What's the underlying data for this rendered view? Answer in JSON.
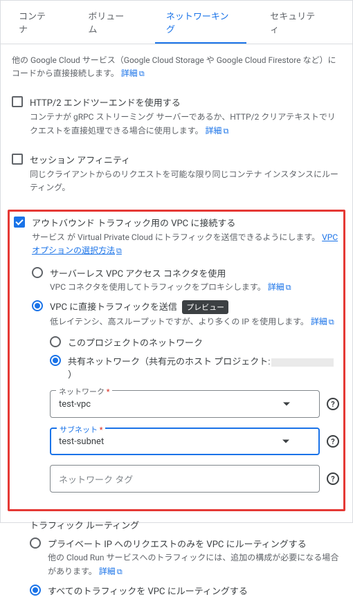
{
  "tabs": {
    "container": "コンテナ",
    "volumes": "ボリューム",
    "networking": "ネットワーキング",
    "security": "セキュリティ"
  },
  "intro": {
    "text": "他の Google Cloud サービス（Google Cloud Storage や Google Cloud Firestore など）にコードから直接接続します。",
    "link_label": "詳細"
  },
  "http2": {
    "title": "HTTP/2 エンドツーエンドを使用する",
    "desc": "コンテナが gRPC ストリーミング サーバーであるか、HTTP/2 クリアテキストでリクエストを直接処理できる場合に使用します。",
    "link_label": "詳細"
  },
  "session_affinity": {
    "title": "セッション アフィニティ",
    "desc": "同じクライアントからのリクエストを可能な限り同じコンテナ インスタンスにルーティング。"
  },
  "vpc_connect": {
    "title": "アウトバウンド トラフィック用の VPC に接続する",
    "desc_prefix": "サービス が Virtual Private Cloud にトラフィックを送信できるようにします。",
    "link_label": "VPC オプションの選択方法"
  },
  "method": {
    "serverless": {
      "title": "サーバーレス VPC アクセス コネクタを使用",
      "desc": "VPC コネクタを使用してトラフィックをプロキシします。",
      "link_label": "詳細"
    },
    "direct": {
      "title_prefix": "VPC に直接トラフィックを送信",
      "badge": "プレビュー",
      "desc": "低レイテンシ、高スループットですが、より多くの IP を使用します。",
      "link_label": "詳細"
    }
  },
  "network_scope": {
    "project": "このプロジェクトのネットワーク",
    "shared_prefix": "共有ネットワーク（共有元のホスト プロジェクト:",
    "shared_suffix": "）"
  },
  "fields": {
    "network": {
      "label": "ネットワーク",
      "value": "test-vpc"
    },
    "subnet": {
      "label": "サブネット",
      "value": "test-subnet"
    },
    "tags": {
      "placeholder": "ネットワーク タグ"
    }
  },
  "routing": {
    "heading": "トラフィック ルーティング",
    "private": {
      "title": "プライベート IP へのリクエストのみを VPC にルーティングする",
      "desc": "他の Cloud Run サービスへのトラフィックには、追加の構成が必要になる場合があります。",
      "link_label": "詳細"
    },
    "all": {
      "title": "すべてのトラフィックを VPC にルーティングする"
    }
  }
}
